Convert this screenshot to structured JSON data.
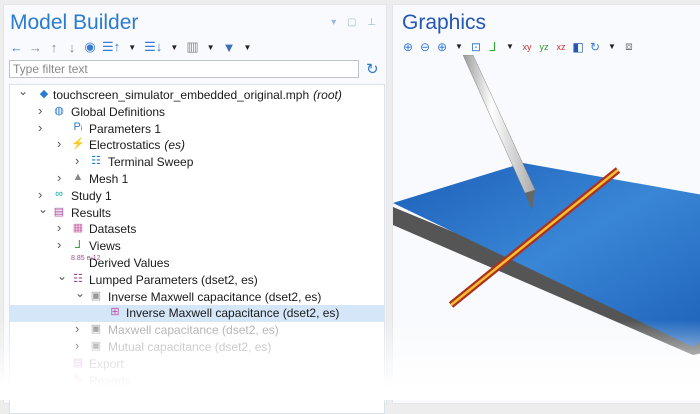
{
  "model_builder": {
    "title": "Model Builder",
    "window_controls": "▾ ▢ ⊥",
    "toolbar": [
      "back-arrow-icon",
      "forward-arrow-icon",
      "move-up-icon",
      "move-down-icon",
      "show-icon",
      "collapse-icon",
      "expand-icon",
      "columns-icon",
      "filter-icon"
    ],
    "filter_placeholder": "Type filter text",
    "tree": [
      {
        "label": "touchscreen_simulator_embedded_original.mph",
        "suffix": "(root)",
        "icon": "model-icon",
        "expanded": true
      },
      {
        "label": "Global Definitions",
        "icon": "globe-icon",
        "expanded": false
      },
      {
        "label": "Parameters 1",
        "icon": "parameters-icon",
        "expanded": false
      },
      {
        "label": "Electrostatics",
        "suffix": "(es)",
        "icon": "electrostatics-icon",
        "expanded": false
      },
      {
        "label": "Terminal Sweep",
        "icon": "terminal-sweep-icon",
        "expanded": false
      },
      {
        "label": "Mesh 1",
        "icon": "mesh-icon",
        "expanded": false
      },
      {
        "label": "Study 1",
        "icon": "study-icon",
        "expanded": false
      },
      {
        "label": "Results",
        "icon": "results-icon",
        "expanded": true
      },
      {
        "label": "Datasets",
        "icon": "datasets-icon",
        "expanded": false
      },
      {
        "label": "Views",
        "icon": "views-icon",
        "expanded": false
      },
      {
        "label": "Derived Values",
        "icon": "derived-values-icon"
      },
      {
        "label": "Lumped Parameters (dset2, es)",
        "icon": "lumped-parameters-icon",
        "expanded": true
      },
      {
        "label": "Inverse Maxwell capacitance (dset2, es)",
        "icon": "table-group-icon",
        "expanded": true
      },
      {
        "label": "Inverse Maxwell capacitance (dset2, es)",
        "icon": "table-icon",
        "selected": true
      },
      {
        "label": "Maxwell capacitance (dset2, es)",
        "icon": "table-group-icon",
        "expanded": false
      },
      {
        "label": "Mutual capacitance (dset2, es)",
        "icon": "table-group-icon",
        "expanded": false
      },
      {
        "label": "Export",
        "icon": "export-icon"
      },
      {
        "label": "Reports",
        "icon": "reports-icon"
      }
    ],
    "derived_icon_text": "8.85 e-12"
  },
  "graphics": {
    "title": "Graphics",
    "toolbar": [
      "zoom-in-icon",
      "zoom-out-icon",
      "zoom-box-icon",
      "zoom-extents-icon",
      "axes-icon",
      "xy-view-icon",
      "yz-view-icon",
      "xz-view-icon",
      "camera-icon",
      "rotate-icon",
      "wireframe-icon"
    ],
    "view_labels": {
      "xy": "xy",
      "yz": "yz",
      "xz": "xz"
    }
  },
  "colors": {
    "accent": "#2b7bd1",
    "selection": "#d4e6f8",
    "plate": "#2a6fc4",
    "hotline": "#f2c230"
  }
}
